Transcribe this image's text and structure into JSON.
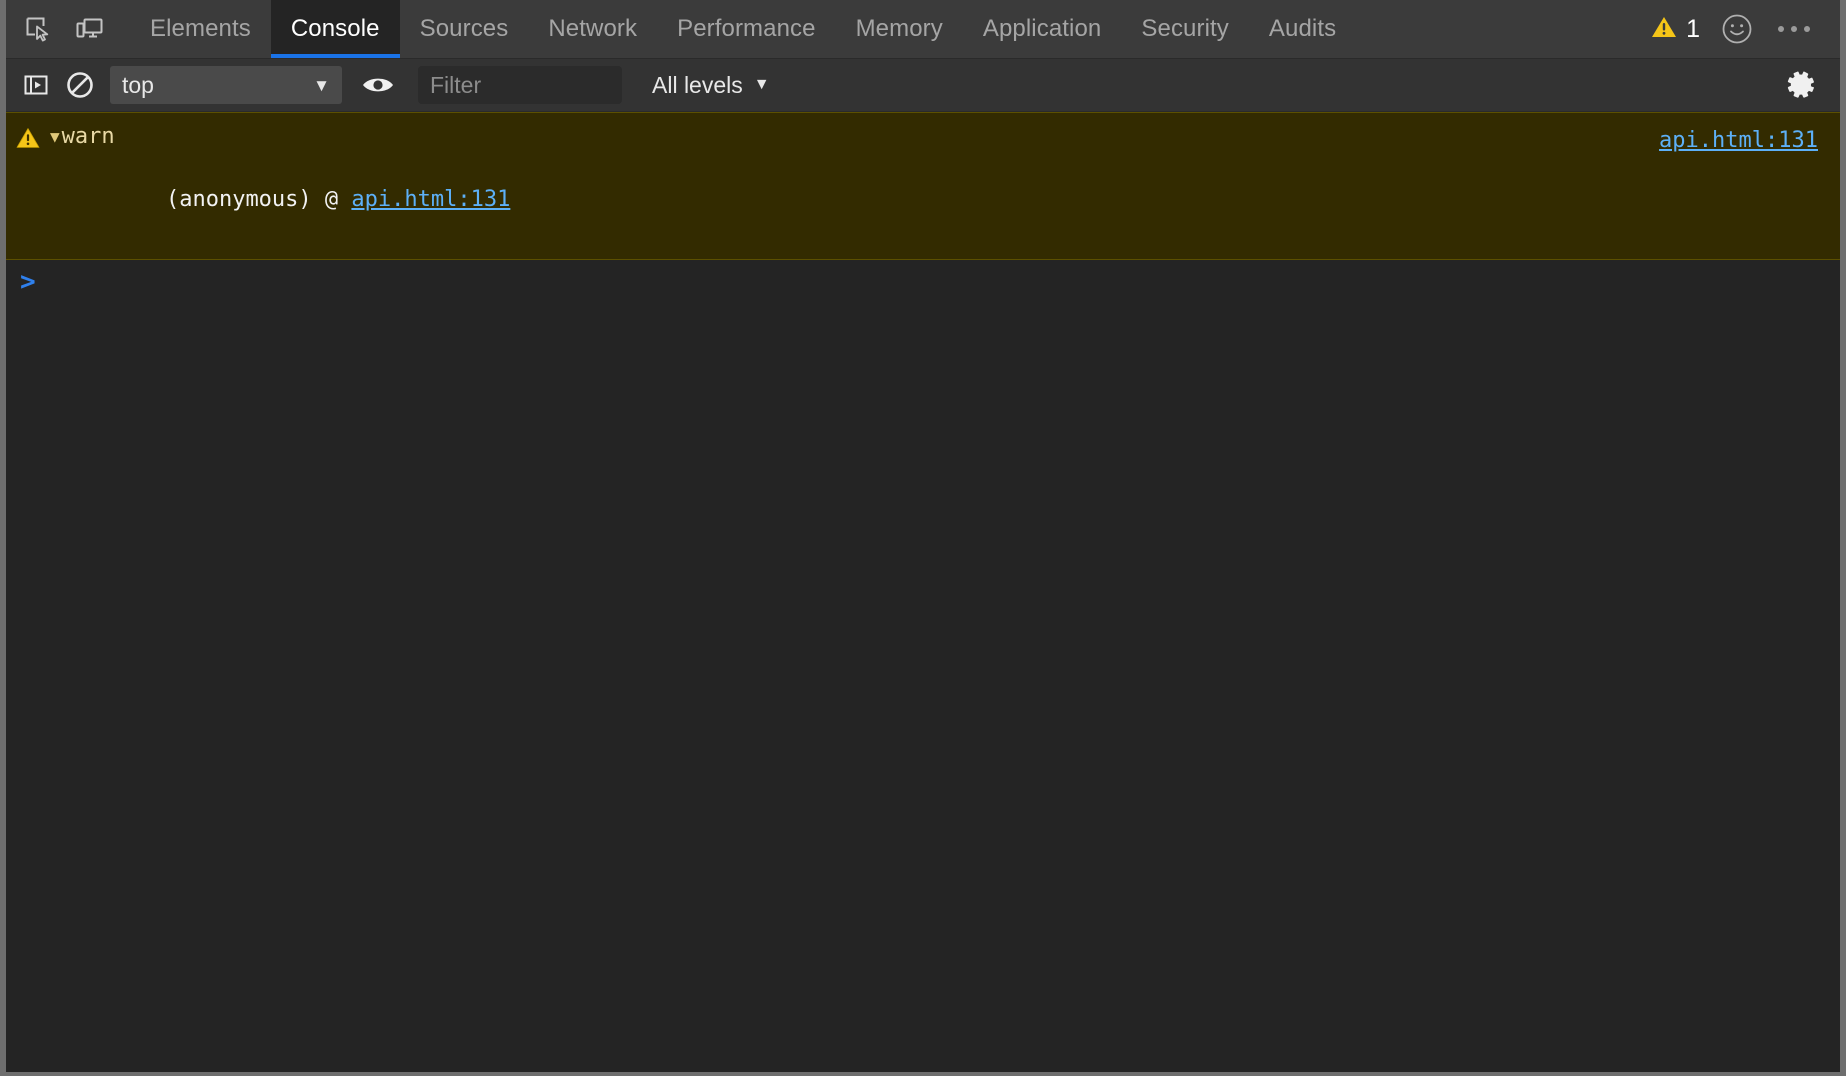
{
  "tabbar": {
    "icons": [
      {
        "name": "inspect-element-icon",
        "title": "Inspect element"
      },
      {
        "name": "device-toolbar-icon",
        "title": "Toggle device toolbar"
      }
    ],
    "tabs": [
      {
        "label": "Elements",
        "active": false
      },
      {
        "label": "Console",
        "active": true
      },
      {
        "label": "Sources",
        "active": false
      },
      {
        "label": "Network",
        "active": false
      },
      {
        "label": "Performance",
        "active": false
      },
      {
        "label": "Memory",
        "active": false
      },
      {
        "label": "Application",
        "active": false
      },
      {
        "label": "Security",
        "active": false
      },
      {
        "label": "Audits",
        "active": false
      }
    ],
    "warning_count": "1",
    "feedback_icon": "smiley-face-icon",
    "more_menu_icon": "three-dots-icon"
  },
  "console_toolbar": {
    "sidebar_toggle_icon": "console-sidebar-toggle-icon",
    "clear_console_icon": "clear-console-icon",
    "context": {
      "value": "top",
      "caret": "▼"
    },
    "eye_icon": "create-live-expression-eye-icon",
    "filter": {
      "value": "",
      "placeholder": "Filter"
    },
    "levels": {
      "value": "All levels",
      "caret": "▼"
    },
    "settings_icon": "settings-gear-icon"
  },
  "console_body": {
    "messages": [
      {
        "type": "warning",
        "icon": "warning-triangle-icon",
        "disclosure": "▼",
        "text": "warn",
        "source_link": "api.html:131",
        "stack": [
          {
            "frame": "(anonymous) @ ",
            "link": "api.html:131"
          }
        ]
      }
    ],
    "prompt": {
      "chevron": ">",
      "value": "",
      "placeholder": ""
    }
  },
  "colors": {
    "accent_blue": "#1a73e8",
    "link_blue": "#5db0f7",
    "warning_bg": "#332b00",
    "warning_border": "#5c5000",
    "warning_yellow": "#f5c518",
    "toolbar_bg": "#333333",
    "tabbar_bg": "#3b3b3b",
    "panel_bg": "#242424",
    "frame_border": "#6e6e6e"
  }
}
